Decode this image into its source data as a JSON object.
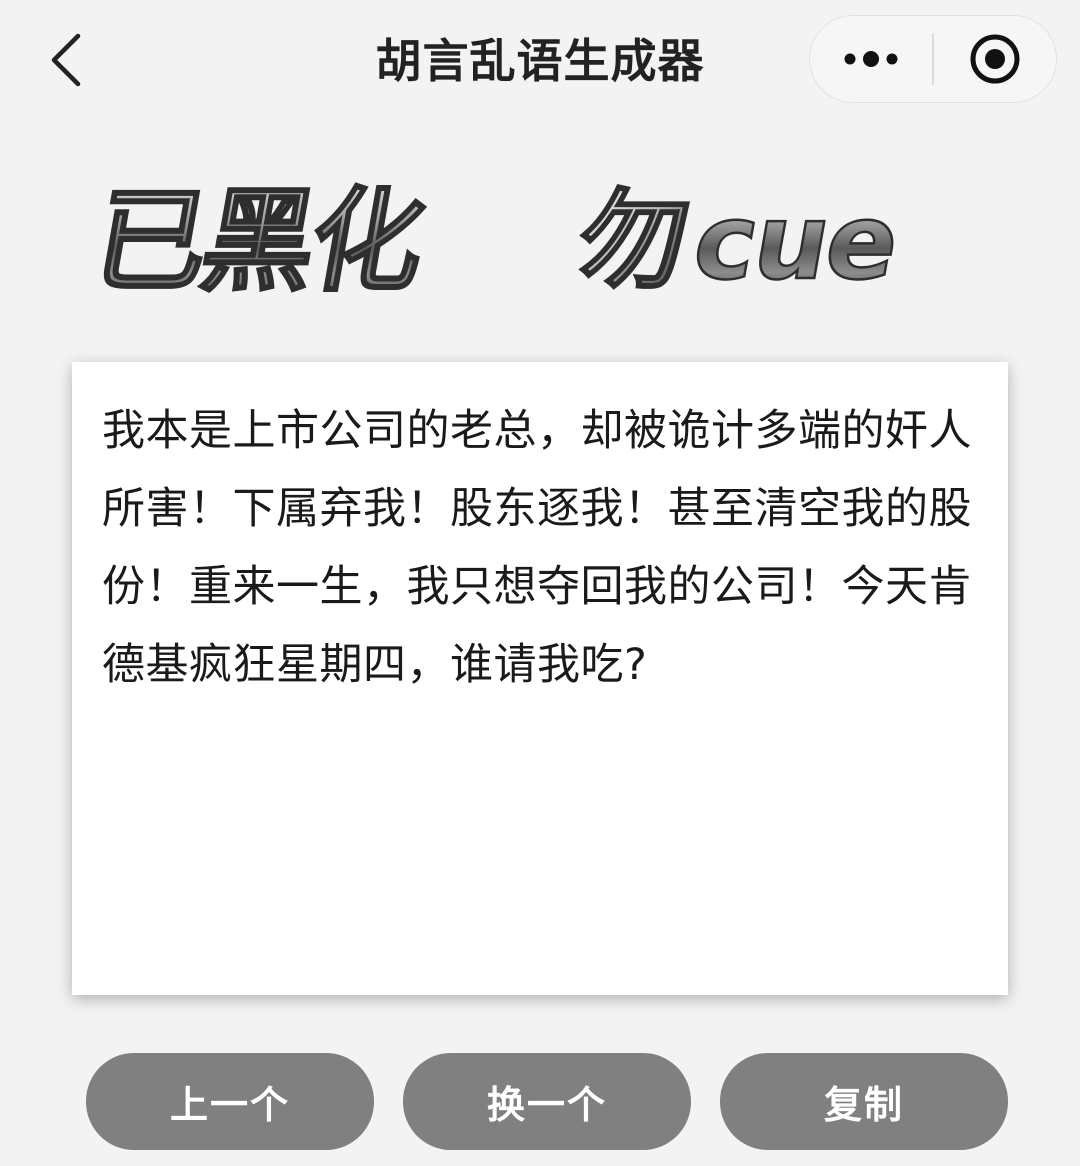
{
  "nav": {
    "title": "胡言乱语生成器",
    "back_icon": "chevron-left-icon",
    "more_icon": "more-dots-icon",
    "close_icon": "record-circle-icon"
  },
  "banner": {
    "text": "已黑化 勿cue",
    "style": "metallic silver 3D lettering"
  },
  "card": {
    "content": "我本是上市公司的老总，却被诡计多端的奸人所害！下属弃我！股东逐我！甚至清空我的股份！重来一生，我只想夺回我的公司！今天肯德基疯狂星期四，谁请我吃?"
  },
  "actions": {
    "prev_label": "上一个",
    "next_label": "换一个",
    "copy_label": "复制"
  },
  "colors": {
    "background": "#f3f3f3",
    "card": "#ffffff",
    "button": "#808080",
    "button_text": "#ffffff",
    "title_text": "#222222"
  }
}
